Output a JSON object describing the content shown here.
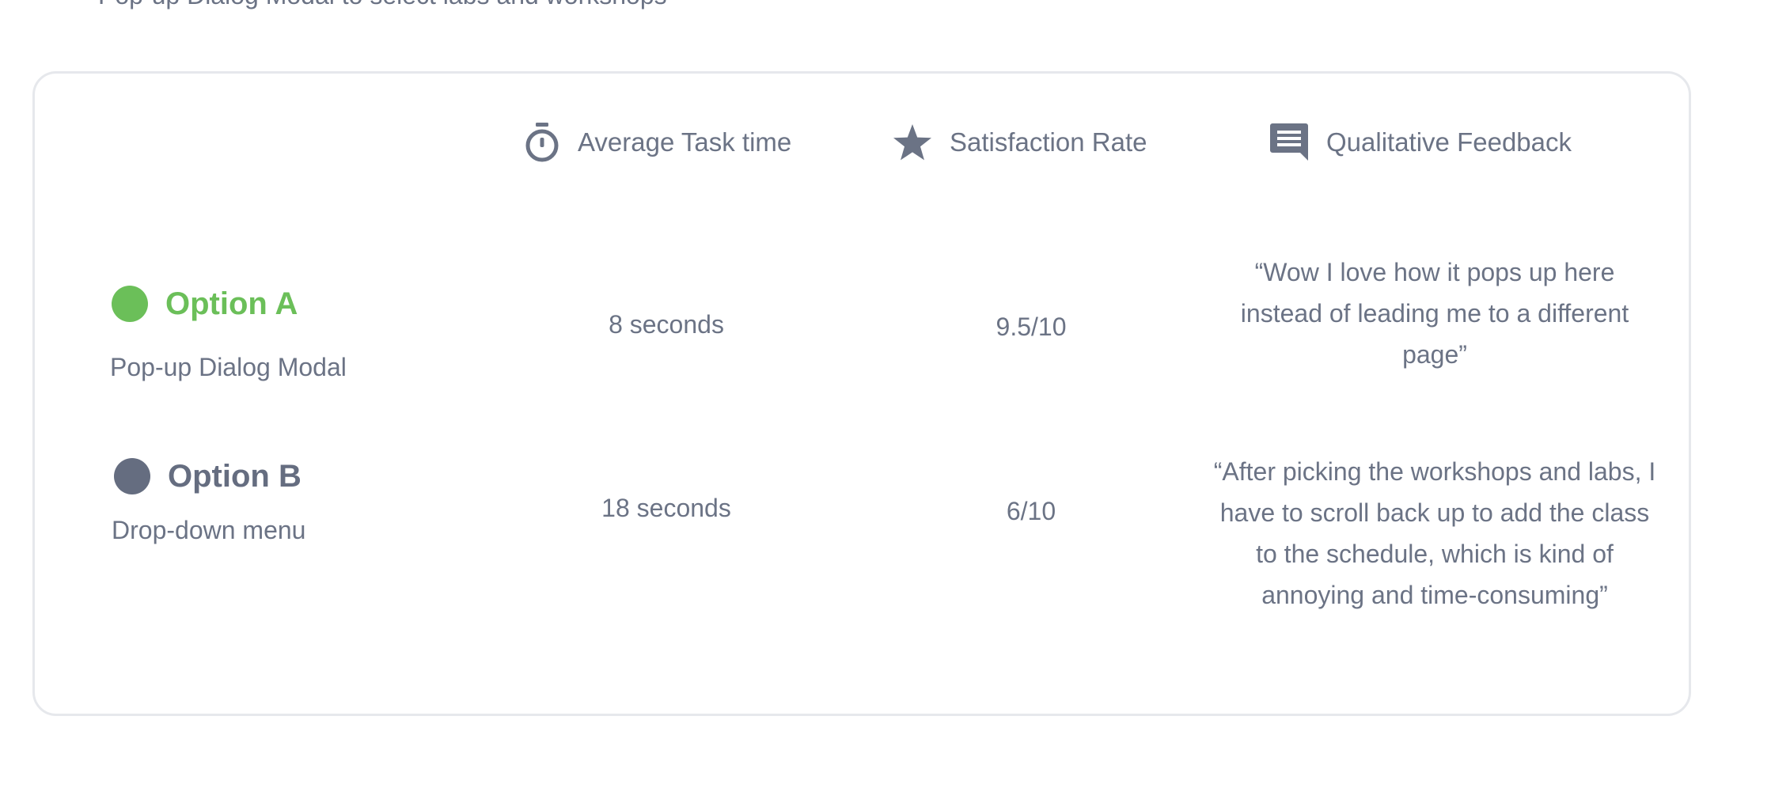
{
  "subtitle": "Pop-up Dialog Modal to select labs and workshops",
  "colors": {
    "text": "#6b7385",
    "option_a": "#6bbf59",
    "option_b": "#656d80",
    "border": "#e6e8ec"
  },
  "columns": {
    "task_time": {
      "label": "Average Task time",
      "icon": "stopwatch-icon"
    },
    "satisfaction": {
      "label": "Satisfaction Rate",
      "icon": "star-icon"
    },
    "feedback": {
      "label": "Qualitative Feedback",
      "icon": "comment-icon"
    }
  },
  "options": [
    {
      "title": "Option A",
      "subtitle": "Pop-up Dialog Modal",
      "task_time": "8 seconds",
      "satisfaction": "9.5/10",
      "feedback": "“Wow I love how it pops up here instead of leading me to a different page”"
    },
    {
      "title": "Option B",
      "subtitle": "Drop-down menu",
      "task_time": "18 seconds",
      "satisfaction": "6/10",
      "feedback": "“After picking the workshops and labs, I have to scroll back up to add the class to the schedule, which is kind of annoying and time-consuming”"
    }
  ]
}
